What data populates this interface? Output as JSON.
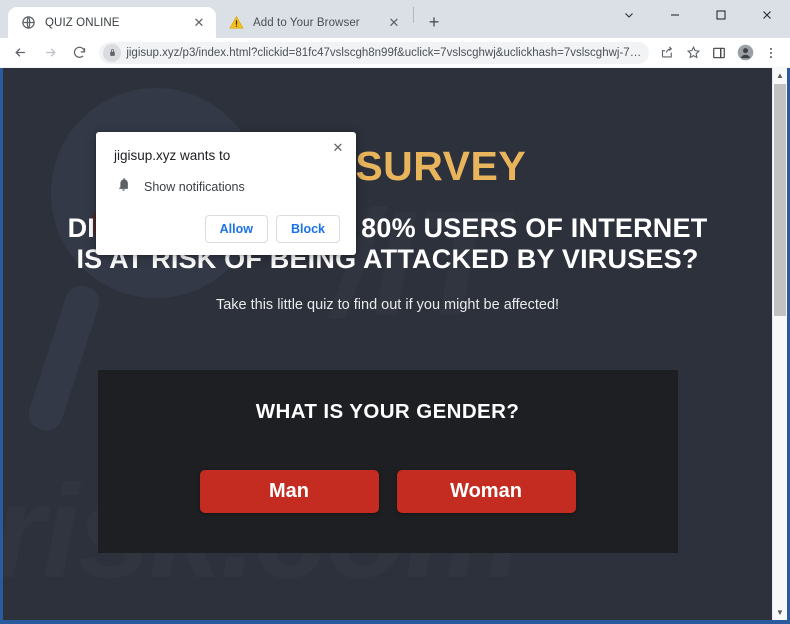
{
  "browser": {
    "tabs": [
      {
        "title": "QUIZ ONLINE",
        "favicon": "globe-icon",
        "active": true,
        "close_label": "✕"
      },
      {
        "title": "Add to Your Browser",
        "favicon": "warning-triangle-icon",
        "active": false,
        "close_label": "✕"
      }
    ],
    "new_tab_label": "+",
    "window_controls": {
      "tab_search": "⌄",
      "minimize": "─",
      "maximize": "☐",
      "close": "✕"
    },
    "toolbar": {
      "back": "←",
      "forward": "→",
      "reload": "↻",
      "lock_icon": "lock-icon",
      "url": "jigisup.xyz/p3/index.html?clickid=81fc47vslscgh8n99f&uclick=7vslscghwj&uclickhash=7vslscghwj-7vsl...",
      "share": "share-icon",
      "bookmark": "star-icon",
      "sidepanel": "side-panel-icon",
      "profile": "profile-avatar-icon",
      "menu": "three-dot-menu-icon"
    }
  },
  "permission_dialog": {
    "title": "jigisup.xyz wants to",
    "permission_icon": "bell-icon",
    "permission_label": "Show notifications",
    "allow_label": "Allow",
    "block_label": "Block",
    "close_label": "✕"
  },
  "page": {
    "hero_title": "RITY SURVEY",
    "hero_subtitle": "DID YOU KNOW THAT 80% USERS OF INTERNET IS AT RISK OF BEING ATTACKED BY VIRUSES?",
    "hero_note": "Take this little quiz to find out if you might be affected!",
    "watermark_main": "risk.com",
    "watermark_top": "/IT",
    "quiz": {
      "question": "WHAT IS YOUR GENDER?",
      "options": [
        {
          "label": "Man"
        },
        {
          "label": "Woman"
        }
      ]
    },
    "colors": {
      "accent_gold": "#e8b55c",
      "button_red": "#c42c21",
      "page_bg": "#2d313b",
      "card_bg": "#1d1f22"
    }
  },
  "scrollbar": {
    "up_arrow": "▲",
    "down_arrow": "▼"
  }
}
